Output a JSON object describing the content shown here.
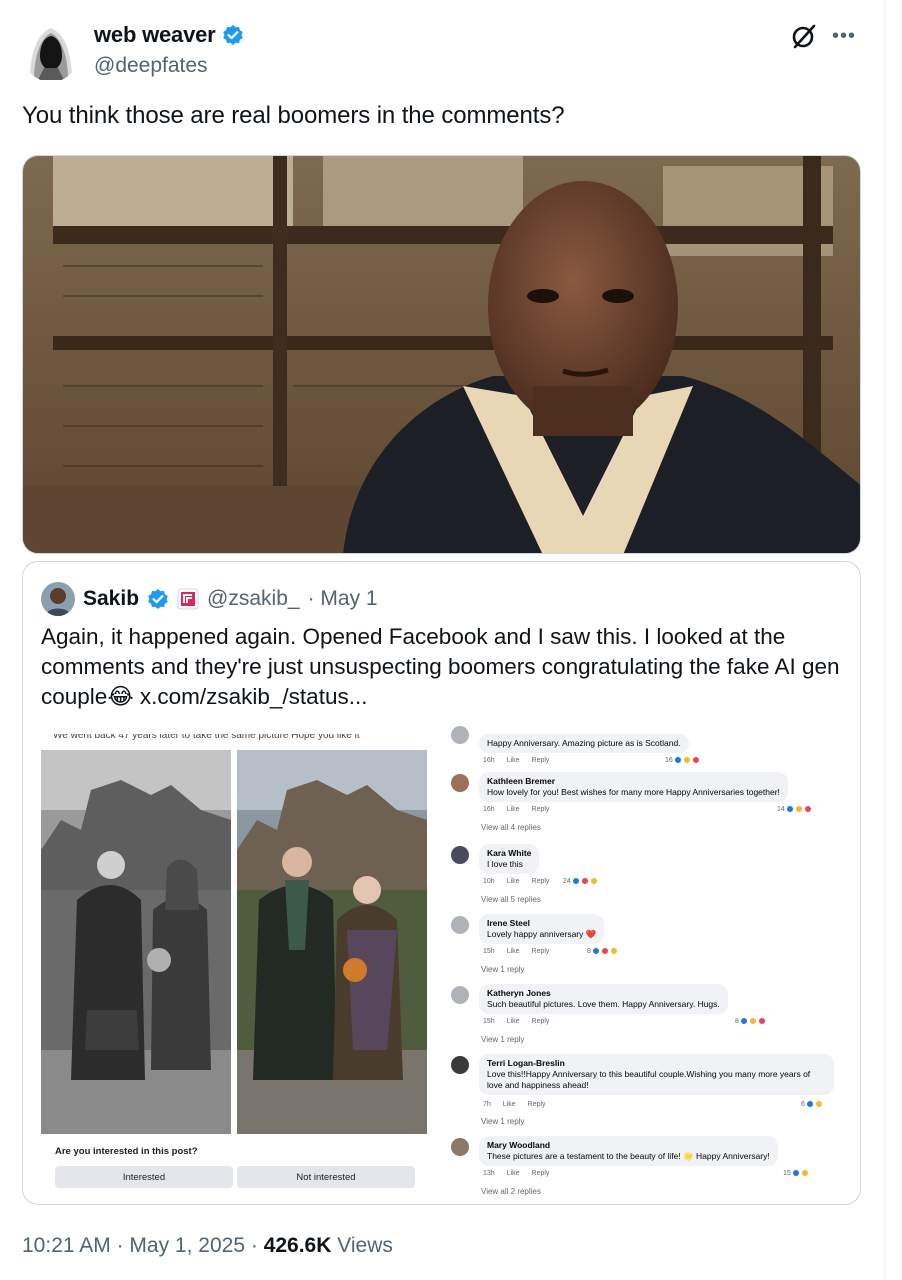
{
  "author": {
    "display_name": "web weaver",
    "handle": "@deepfates"
  },
  "tweet": {
    "text": "You think those are real boomers in the comments?",
    "time": "10:21 AM",
    "date": "May 1, 2025",
    "views_count": "426.6K",
    "views_label": "Views"
  },
  "quote": {
    "display_name": "Sakib",
    "handle": "@zsakib_",
    "date": "· May 1",
    "text": "Again, it happened again. Opened Facebook and I saw this. I looked at the comments and they're just unsuspecting boomers congratulating the fake AI gen couple",
    "emoji": "😂",
    "link": "x.com/zsakib_/status..."
  },
  "fb_post": {
    "caption_cut": "We went back 47 years later to take the same picture Hope you like it",
    "question": "Are you interested in this post?",
    "interested": "Interested",
    "not_interested": "Not interested"
  },
  "fb_comments": [
    {
      "author": "",
      "text": "Happy Anniversary. Amazing picture as is Scotland.",
      "time": "16h",
      "count": "16",
      "replies": ""
    },
    {
      "author": "Kathleen Bremer",
      "text": "How lovely for you! Best wishes for many more Happy Anniversaries together!",
      "time": "16h",
      "count": "14",
      "replies": "View all 4 replies"
    },
    {
      "author": "Kara White",
      "text": "I love this",
      "time": "10h",
      "count": "24",
      "replies": "View all 5 replies"
    },
    {
      "author": "Irene Steel",
      "text": "Lovely happy anniversary ❤️",
      "time": "15h",
      "count": "8",
      "replies": "View 1 reply"
    },
    {
      "author": "Katheryn Jones",
      "text": "Such beautiful pictures. Love them. Happy Anniversary. Hugs.",
      "time": "15h",
      "count": "8",
      "replies": "View 1 reply"
    },
    {
      "author": "Terri Logan-Breslin",
      "text": "Love this!!Happy Anniversary to this beautiful couple.Wishing you many more years of love and happiness ahead!",
      "time": "7h",
      "count": "6",
      "replies": "View 1 reply"
    },
    {
      "author": "Mary Woodland",
      "text": "These pictures are a testament to the beauty of life! 🌟 Happy Anniversary!",
      "time": "13h",
      "count": "15",
      "replies": "View all 2 replies"
    }
  ],
  "fb_labels": {
    "like": "Like",
    "reply": "Reply"
  },
  "colors": {
    "verified": "#1d9bf0",
    "muted_text": "#536471",
    "border": "#cfd9de"
  }
}
